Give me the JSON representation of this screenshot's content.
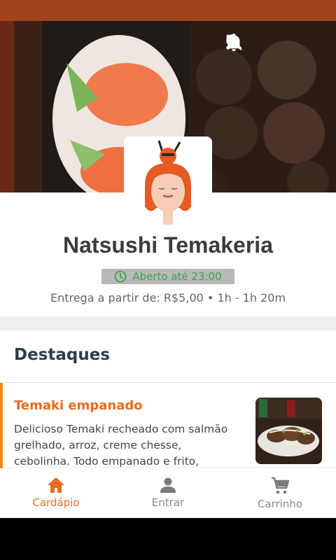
{
  "header": {
    "icons": [
      "bell-icon",
      "search-icon",
      "more-vert-icon"
    ]
  },
  "store": {
    "name": "Natsushi Temakeria",
    "open_status": "Aberto até 23:00",
    "delivery_info": "Entrega a partir de: R$5,00 • 1h - 1h 20m"
  },
  "highlights": {
    "title": "Destaques",
    "items": [
      {
        "name": "Temaki empanado",
        "description": "Delicioso Temaki recheado com salmão grelhado, arroz, creme chesse, cebolinha. Todo empanado e frito, corta…"
      }
    ]
  },
  "bottom_nav": {
    "items": [
      {
        "label": "Cardápio",
        "icon": "home-icon",
        "active": true
      },
      {
        "label": "Entrar",
        "icon": "person-icon",
        "active": false
      },
      {
        "label": "Carrinho",
        "icon": "cart-icon",
        "active": false
      }
    ]
  },
  "colors": {
    "accent": "#e86b1f",
    "status_bar": "#a0421c",
    "open_green": "#39a54a"
  }
}
